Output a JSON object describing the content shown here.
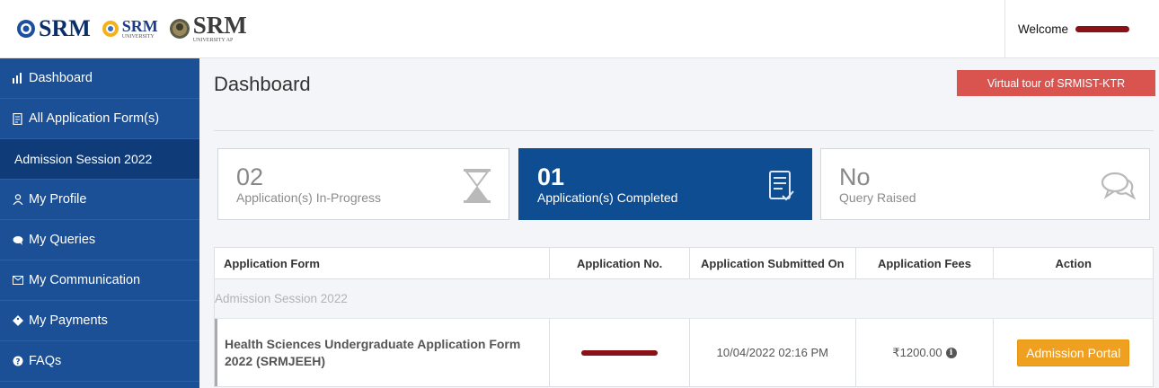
{
  "header": {
    "logos": [
      {
        "word": "SRM",
        "tiny": ""
      },
      {
        "word": "SRM",
        "tiny": "UNIVERSITY"
      },
      {
        "word": "SRM",
        "tiny": "UNIVERSITY AP"
      }
    ],
    "welcome_label": "Welcome"
  },
  "sidebar": {
    "items": [
      {
        "label": "Dashboard",
        "icon": "bar-chart-icon"
      },
      {
        "label": "All Application Form(s)",
        "icon": "document-icon"
      },
      {
        "label": "Admission Session 2022",
        "icon": ""
      },
      {
        "label": "My Profile",
        "icon": "user-icon"
      },
      {
        "label": "My Queries",
        "icon": "chat-icon"
      },
      {
        "label": "My Communication",
        "icon": "mail-icon"
      },
      {
        "label": "My Payments",
        "icon": "tag-icon"
      },
      {
        "label": "FAQs",
        "icon": "question-icon"
      }
    ]
  },
  "main": {
    "title": "Dashboard",
    "tour_button": "Virtual tour of SRMIST-KTR",
    "cards": [
      {
        "number": "02",
        "label": "Application(s) In-Progress",
        "icon": "hourglass-icon"
      },
      {
        "number": "01",
        "label": "Application(s) Completed",
        "icon": "checklist-icon"
      },
      {
        "number": "No",
        "label": "Query Raised",
        "icon": "chat-bubbles-icon"
      }
    ],
    "table": {
      "headers": [
        "Application Form",
        "Application No.",
        "Application Submitted On",
        "Application Fees",
        "Action"
      ],
      "group": "Admission Session 2022",
      "rows": [
        {
          "form": "Health Sciences Undergraduate Application Form 2022 (SRMJEEH)",
          "submitted_on": "10/04/2022 02:16 PM",
          "fees": "₹1200.00",
          "action": "Admission Portal"
        }
      ]
    }
  },
  "colors": {
    "sidebar": "#1b4f96",
    "sidebar_active": "#0f3b78",
    "card_active": "#0f4d92",
    "tour_button": "#d9534f",
    "portal_button": "#f0a020"
  }
}
